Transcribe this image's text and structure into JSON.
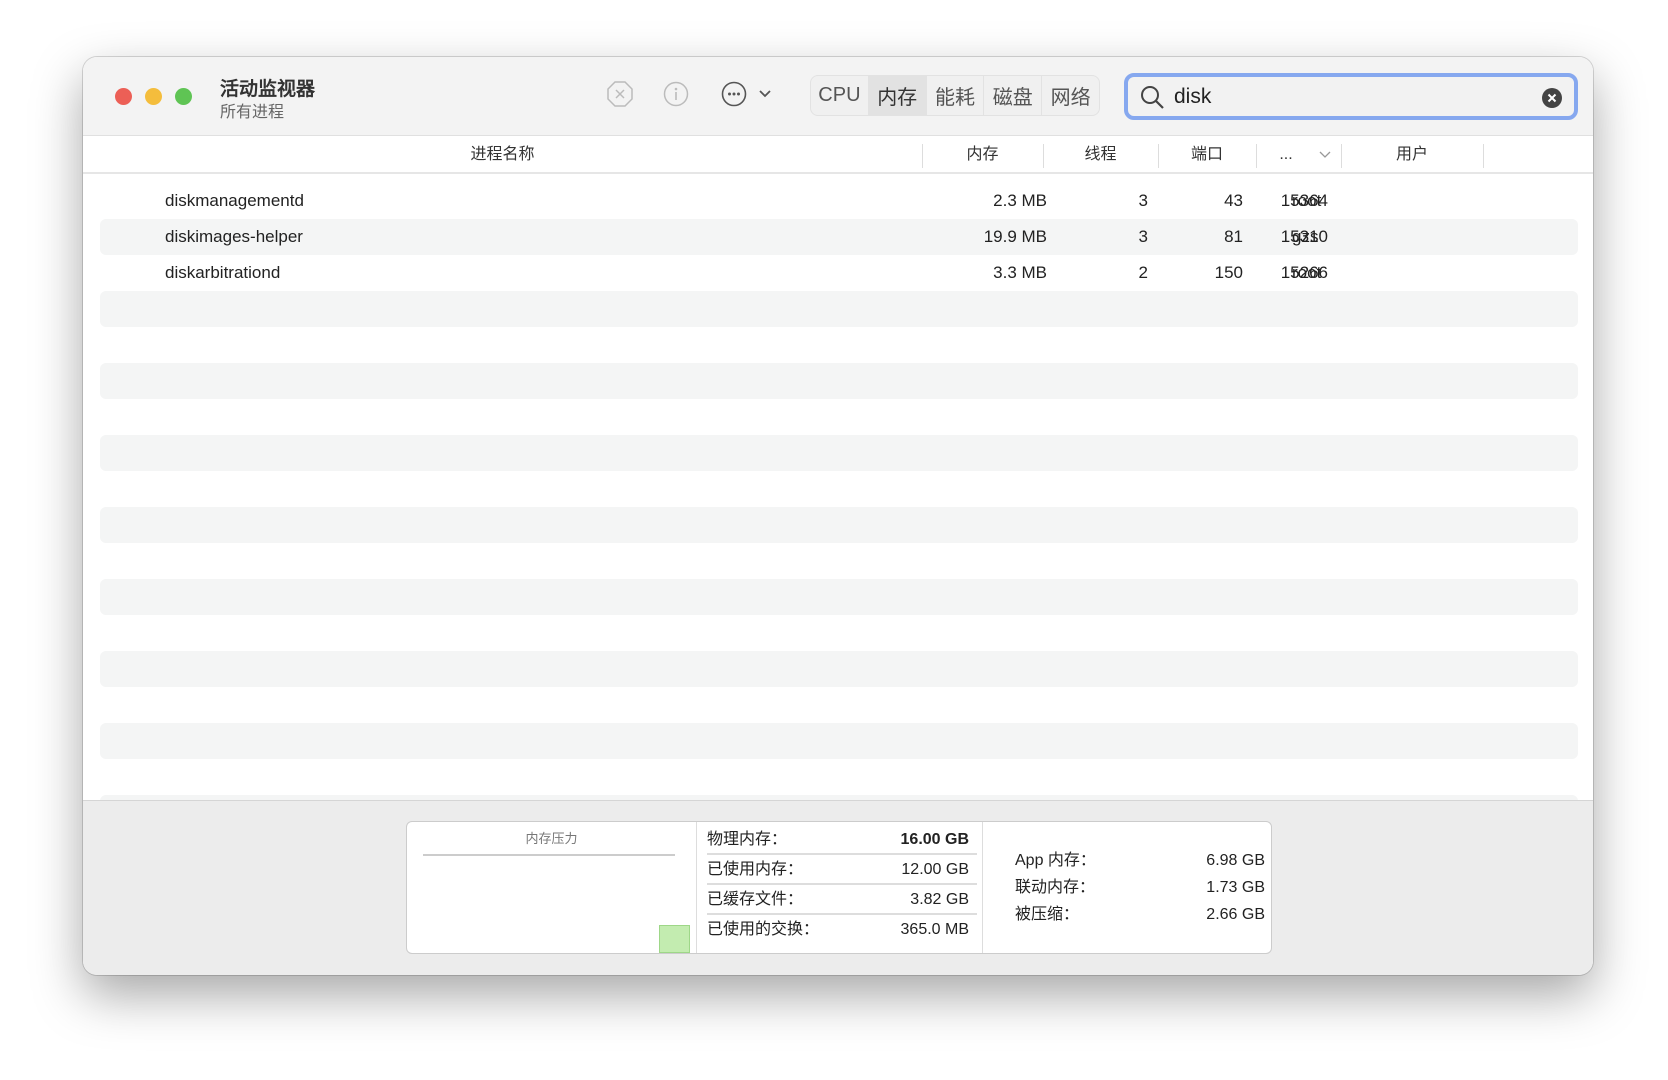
{
  "window": {
    "title": "活动监视器",
    "subtitle": "所有进程"
  },
  "toolbar": {
    "icons": [
      "stop-icon",
      "info-icon",
      "more-icon",
      "chevron-down-icon"
    ],
    "tabs": [
      {
        "label": "CPU",
        "active": false
      },
      {
        "label": "内存",
        "active": true
      },
      {
        "label": "能耗",
        "active": false
      },
      {
        "label": "磁盘",
        "active": false
      },
      {
        "label": "网络",
        "active": false
      }
    ],
    "search": {
      "value": "disk"
    }
  },
  "table": {
    "columns": [
      "进程名称",
      "内存",
      "线程",
      "端口",
      "...",
      "用户"
    ],
    "rows": [
      {
        "name": "diskmanagementd",
        "memory": "2.3 MB",
        "threads": "3",
        "ports": "43",
        "pid": "15364",
        "user": "root"
      },
      {
        "name": "diskimages-helper",
        "memory": "19.9 MB",
        "threads": "3",
        "ports": "81",
        "pid": "15310",
        "user": "gzs"
      },
      {
        "name": "diskarbitrationd",
        "memory": "3.3 MB",
        "threads": "2",
        "ports": "150",
        "pid": "15266",
        "user": "root"
      }
    ]
  },
  "footer": {
    "pressure_label": "内存压力",
    "pressure_color": "#c3ecb0",
    "stats": [
      {
        "label": "物理内存：",
        "value": "16.00 GB"
      },
      {
        "label": "已使用内存：",
        "value": "12.00 GB"
      },
      {
        "label": "已缓存文件：",
        "value": "3.82 GB"
      },
      {
        "label": "已使用的交换：",
        "value": "365.0 MB"
      }
    ],
    "details": [
      {
        "label": "App 内存：",
        "value": "6.98 GB"
      },
      {
        "label": "联动内存：",
        "value": "1.73 GB"
      },
      {
        "label": "被压缩：",
        "value": "2.66 GB"
      }
    ]
  }
}
